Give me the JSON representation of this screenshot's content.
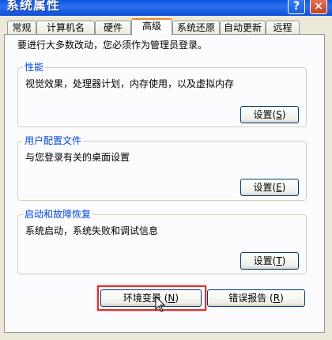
{
  "window": {
    "title": "系统属性"
  },
  "titlebar_buttons": {
    "help": "?",
    "close": "×"
  },
  "tabs": [
    {
      "label": "常规"
    },
    {
      "label": "计算机名"
    },
    {
      "label": "硬件"
    },
    {
      "label": "高级",
      "active": true
    },
    {
      "label": "系统还原"
    },
    {
      "label": "自动更新"
    },
    {
      "label": "远程"
    }
  ],
  "intro": "要进行大多数改动，您必须作为管理员登录。",
  "performance": {
    "title": "性能",
    "description": "视觉效果，处理器计划，内存使用，以及虚拟内存",
    "button": "设置",
    "accel": "S"
  },
  "user_profiles": {
    "title": "用户配置文件",
    "description": "与您登录有关的桌面设置",
    "button": "设置",
    "accel": "E"
  },
  "startup_recovery": {
    "title": "启动和故障恢复",
    "description": "系统启动，系统失败和调试信息",
    "button": "设置",
    "accel": "T"
  },
  "bottom_buttons": {
    "env_vars": {
      "label": "环境变量",
      "accel": "N"
    },
    "error_report": {
      "label": "错误报告",
      "accel": "R"
    }
  },
  "colors": {
    "titlebar": "#0a58e0",
    "group_title": "#0046d5",
    "highlight": "#e03030",
    "active_tab": "#e68b2c"
  },
  "icons": {
    "cursor": "arrow-pointer-icon"
  }
}
